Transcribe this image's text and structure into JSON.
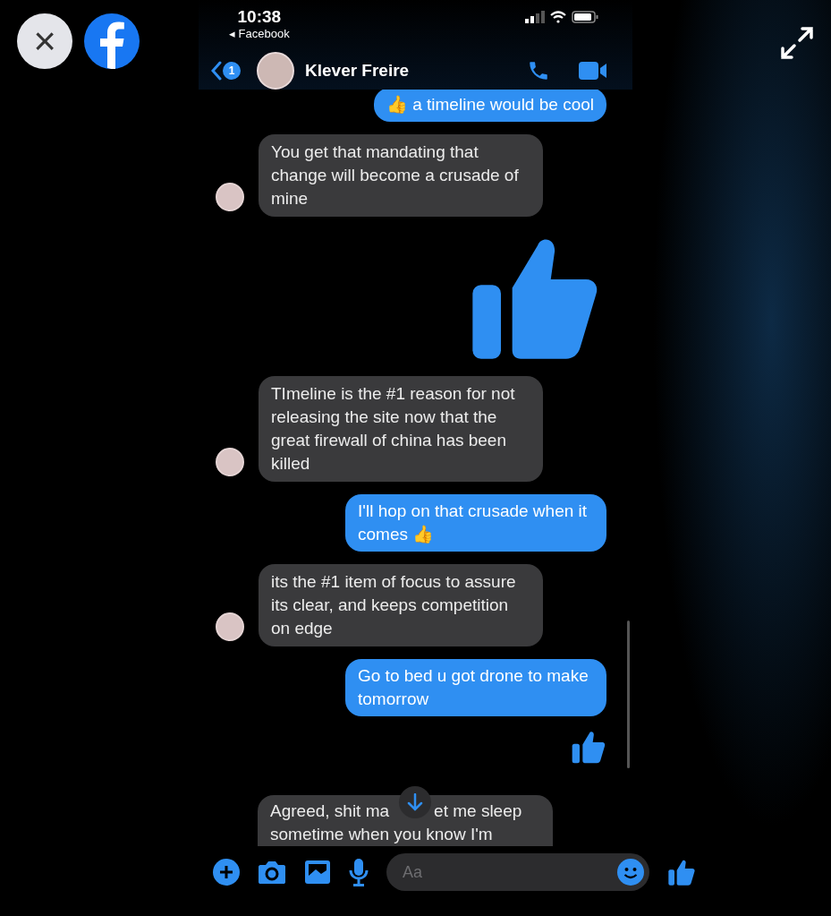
{
  "viewer": {
    "close_label": "×"
  },
  "status_bar": {
    "time": "10:38",
    "back_app": "◂ Facebook"
  },
  "header": {
    "unread_count": "1",
    "contact_name": "Klever Freire"
  },
  "messages": [
    {
      "kind": "sent",
      "text": "👍 a timeline would be cool"
    },
    {
      "kind": "received",
      "text": "You get that mandating that change will become a crusade of mine"
    },
    {
      "kind": "sticker"
    },
    {
      "kind": "received",
      "text": "TImeline is the #1 reason for not releasing the site now that the great firewall of china has been killed"
    },
    {
      "kind": "sent",
      "text": "I'll hop on that crusade when it comes 👍"
    },
    {
      "kind": "received",
      "text": "its the #1 item of focus to assure its clear, and keeps competition on edge"
    },
    {
      "kind": "sent",
      "text": "Go to bed u got drone to make tomorrow"
    },
    {
      "kind": "like"
    },
    {
      "kind": "partial",
      "text_before": "Agreed, shit ma",
      "text_after": "et me sleep",
      "text_rest": "sometime when you know I'm"
    }
  ],
  "composer": {
    "placeholder": "Aa"
  }
}
